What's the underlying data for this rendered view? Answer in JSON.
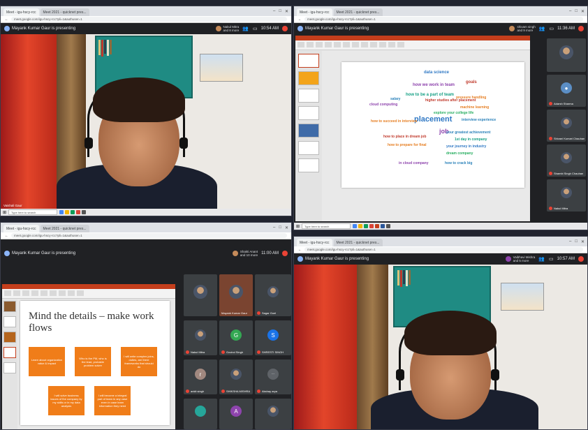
{
  "common": {
    "tab_meet": "Meet - igu-hscy-rcc",
    "tab_other": "Meet 2021 - quicknet pres...",
    "url": "meet.google.com/igu-hscy-rcc?pli=1&authuser=1",
    "search_placeholder": "Type here to search"
  },
  "p1": {
    "presenter": "Mayank Kumar Gaur is presenting",
    "viewer": "Nakul Mitra\nand 8 more",
    "time": "10:54 AM",
    "cam_name": "Vaishali Gaur"
  },
  "p2": {
    "presenter": "Mayank Kumar Gaur is presenting",
    "viewer": "shivam singh\nand 9 more",
    "time": "11:36 AM",
    "participants": [
      {
        "name": "Adarsh Sharma"
      },
      {
        "name": "Shivani Kumari Chauhan"
      },
      {
        "name": "Shambi Singh Chauhan"
      },
      {
        "name": "Nakul Mitra"
      }
    ],
    "wordcloud": {
      "words": [
        {
          "t": "data science",
          "c": "#2f78c4"
        },
        {
          "t": "machine learning",
          "c": "#e67e22"
        },
        {
          "t": "how we work in team",
          "c": "#8e44ad"
        },
        {
          "t": "goals",
          "c": "#c0392b"
        },
        {
          "t": "how to be a part of team",
          "c": "#16a085"
        },
        {
          "t": "pressure handling",
          "c": "#e67e22"
        },
        {
          "t": "salary",
          "c": "#2980b9"
        },
        {
          "t": "higher studies after placement",
          "c": "#c0392b"
        },
        {
          "t": "cloud computing",
          "c": "#8e44ad"
        },
        {
          "t": "explore your college life",
          "c": "#27ae60"
        },
        {
          "t": "placement",
          "c": "#2f78c4"
        },
        {
          "t": "interview experience",
          "c": "#2980b9"
        },
        {
          "t": "how to succeed in interview",
          "c": "#e67e22"
        },
        {
          "t": "job",
          "c": "#8e44ad"
        },
        {
          "t": "your greatest achievement",
          "c": "#2980b9"
        },
        {
          "t": "1st day in company",
          "c": "#16a085"
        },
        {
          "t": "how to place in dream job",
          "c": "#c0392b"
        },
        {
          "t": "how to prepare for final",
          "c": "#e67e22"
        },
        {
          "t": "your journey in industry",
          "c": "#2f78c4"
        },
        {
          "t": "dream company",
          "c": "#27ae60"
        },
        {
          "t": "in cloud company",
          "c": "#8e44ad"
        },
        {
          "t": "how to crack big",
          "c": "#2980b9"
        }
      ]
    }
  },
  "p3": {
    "presenter": "Mayank Kumar Gaur is presenting",
    "viewer": "Shakti Anant\nand 10 more",
    "time": "11:00 AM",
    "slide": {
      "title": "Mind the details – make work flows",
      "boxes": [
        "Learn about organization value & impact",
        "Who is the PM, who is the lead, probable problem solver",
        "I will write complex joins, duties, are there frameworks that should do",
        "I will solve business issues of the company by my skills or in my data analysis",
        "I will become a integral part of team in any case even in case learn information they need"
      ]
    },
    "participants": [
      {
        "name": "Mayank Kumar Gaur"
      },
      {
        "name": "Sagar Goel"
      },
      {
        "name": "Nakul Mitra",
        "initial": ""
      },
      {
        "name": "Govind Singh",
        "initial": "G"
      },
      {
        "name": "SHRESTI SINGH",
        "initial": "S"
      },
      {
        "name": "ankit singh",
        "initial": "r"
      },
      {
        "name": "SHIKSHA MISHRA"
      },
      {
        "name": "Akshay arya"
      },
      {
        "name": ""
      },
      {
        "name": "",
        "initial": "A"
      },
      {
        "name": ""
      }
    ]
  },
  "p4": {
    "presenter": "Mayank Kumar Gaur is presenting",
    "viewer": "Vaibhavi Mishra\nand 5 more",
    "time": "10:57 AM"
  },
  "colors": {
    "meet_bg": "#202124",
    "accent_orange": "#f07d19",
    "ppt_red": "#c43e1c",
    "endcall": "#ea4335"
  }
}
